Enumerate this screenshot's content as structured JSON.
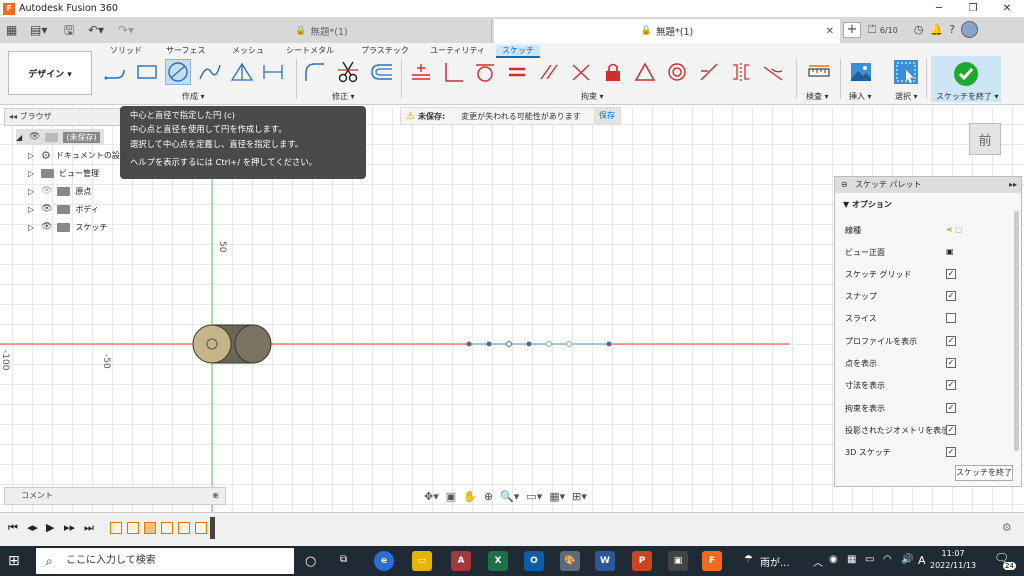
{
  "window": {
    "title": "Autodesk Fusion 360",
    "app_icon": "F"
  },
  "tabs": [
    {
      "label": "無題*(1)",
      "active": false
    },
    {
      "label": "無題*(1)",
      "active": true
    }
  ],
  "header_right": {
    "job_status": "6/10"
  },
  "workspace_tabs": [
    "ソリッド",
    "サーフェス",
    "メッシュ",
    "シートメタル",
    "プラスチック",
    "ユーティリティ",
    "スケッチ"
  ],
  "workspace_active": "スケッチ",
  "design_button": "デザイン ▾",
  "tool_groups": {
    "create": "作成 ▾",
    "modify": "修正 ▾",
    "constraints": "拘束 ▾",
    "inspect": "検査 ▾",
    "insert": "挿入 ▾",
    "select": "選択 ▾",
    "finish": "スケッチを終了 ▾"
  },
  "browser": {
    "title": "ブラウザ",
    "items": [
      {
        "label": "(未保存)",
        "type": "root"
      },
      {
        "label": "ドキュメントの設定",
        "type": "settings"
      },
      {
        "label": "ビュー管理",
        "type": "folder"
      },
      {
        "label": "原点",
        "type": "folder"
      },
      {
        "label": "ボディ",
        "type": "folder"
      },
      {
        "label": "スケッチ",
        "type": "folder"
      }
    ]
  },
  "tooltip": {
    "title": "中心と直径で指定した円 (c)",
    "line1": "中心点と直径を使用して円を作成します。",
    "line2": "選択して中心点を定義し、直径を指定します。",
    "line3": "ヘルプを表示するには Ctrl+/ を押してください。"
  },
  "banner": {
    "label": "未保存:",
    "message": "変更が失われる可能性があります",
    "save": "保存"
  },
  "viewcube": {
    "face": "前"
  },
  "axis_labels": {
    "y50": "50",
    "x_minus50": "-50",
    "x_minus100": "-100"
  },
  "palette": {
    "title": "スケッチ パレット",
    "section": "▼ オプション",
    "options": [
      {
        "label": "線種",
        "control": "linetype"
      },
      {
        "label": "ビュー正面",
        "control": "button"
      },
      {
        "label": "スケッチ グリッド",
        "checked": true
      },
      {
        "label": "スナップ",
        "checked": true
      },
      {
        "label": "スライス",
        "checked": false
      },
      {
        "label": "プロファイルを表示",
        "checked": true
      },
      {
        "label": "点を表示",
        "checked": true
      },
      {
        "label": "寸法を表示",
        "checked": true
      },
      {
        "label": "拘束を表示",
        "checked": true
      },
      {
        "label": "投影されたジオメトリを表示",
        "checked": true
      },
      {
        "label": "3D スケッチ",
        "checked": true
      }
    ],
    "finish": "スケッチを終了"
  },
  "comments": {
    "label": "コメント"
  },
  "taskbar": {
    "search_placeholder": "ここに入力して検索",
    "weather": "雨が...",
    "ime": "A",
    "time": "11:07",
    "date": "2022/11/13",
    "notifications": "24"
  },
  "colors": {
    "accent": "#0a6ebd",
    "sketch_tool_red": "#d42b2b",
    "axis_red": "#e8423a",
    "axis_green": "#5bc85b",
    "taskbar": "#1f2a35"
  }
}
